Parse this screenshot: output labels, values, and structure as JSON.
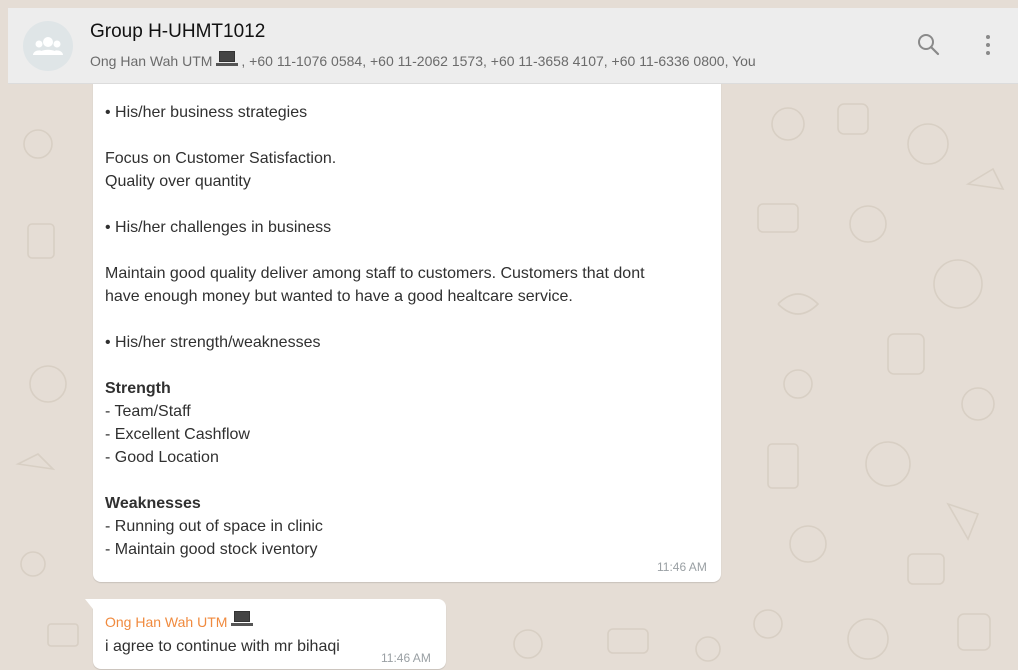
{
  "header": {
    "title": "Group H-UHMT1012",
    "subtitle_pre": "Ong Han Wah UTM",
    "subtitle_post": ", +60 11-1076 0584, +60 11-2062 1573, +60 11-3658 4107, +60 11-6336 0800, You"
  },
  "message1": {
    "lines": [
      "• His/her business strategies",
      "",
      "Focus on Customer Satisfaction.",
      "Quality over quantity",
      "",
      "• His/her challenges in business",
      "",
      "Maintain good quality deliver among staff to customers. Customers that dont",
      "have enough money but wanted to have a good healtcare service.",
      "",
      "• His/her strength/weaknesses",
      "",
      "Strength",
      "- Team/Staff",
      "- Excellent Cashflow",
      "- Good Location",
      "",
      "Weaknesses",
      "- Running out of space in clinic",
      "- Maintain good stock iventory"
    ],
    "time": "11:46 AM"
  },
  "message2": {
    "sender": "Ong Han Wah UTM",
    "text": "i agree to continue with mr bihaqi",
    "time": "11:46 AM"
  },
  "colors": {
    "header_bg": "#ededed",
    "chat_bg": "#e5ddd5",
    "sender_color": "#f08a3e"
  },
  "icons": [
    "group-avatar-icon",
    "laptop-emoji-icon",
    "search-icon",
    "menu-dots-icon"
  ]
}
